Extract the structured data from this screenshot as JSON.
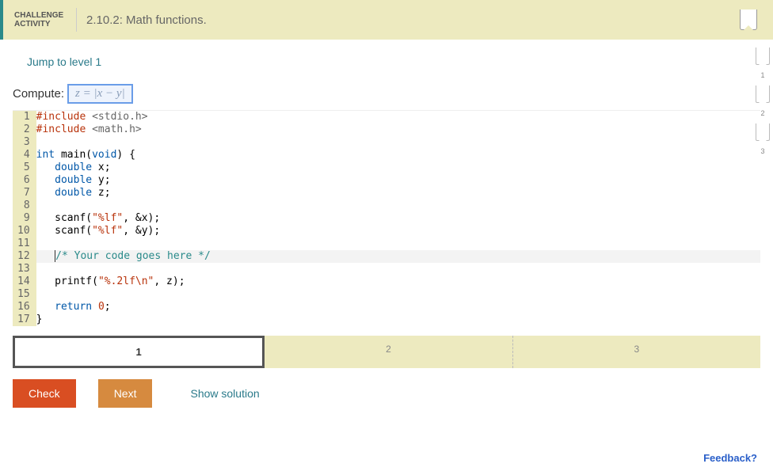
{
  "header": {
    "challenge_label_l1": "CHALLENGE",
    "challenge_label_l2": "ACTIVITY",
    "title": "2.10.2: Math functions."
  },
  "jump_link": "Jump to level 1",
  "compute": {
    "prefix": "Compute:",
    "formula": "z = |x − y|"
  },
  "code_lines": [
    {
      "n": 1,
      "html": "<span class='pp'>#include</span> <span class='inc'>&lt;stdio.h&gt;</span>"
    },
    {
      "n": 2,
      "html": "<span class='pp'>#include</span> <span class='inc'>&lt;math.h&gt;</span>"
    },
    {
      "n": 3,
      "html": ""
    },
    {
      "n": 4,
      "html": "<span class='kw'>int</span> main(<span class='kw'>void</span>) {"
    },
    {
      "n": 5,
      "html": "   <span class='typ'>double</span> x;"
    },
    {
      "n": 6,
      "html": "   <span class='typ'>double</span> y;"
    },
    {
      "n": 7,
      "html": "   <span class='typ'>double</span> z;"
    },
    {
      "n": 8,
      "html": ""
    },
    {
      "n": 9,
      "html": "   scanf(<span class='str'>\"%lf\"</span>, &amp;x);"
    },
    {
      "n": 10,
      "html": "   scanf(<span class='str'>\"%lf\"</span>, &amp;y);"
    },
    {
      "n": 11,
      "html": ""
    },
    {
      "n": 12,
      "html": "   <span class='cursor'></span><span class='cmt'>/* Your code goes here */</span>",
      "hl": true
    },
    {
      "n": 13,
      "html": ""
    },
    {
      "n": 14,
      "html": "   printf(<span class='str'>\"%.2lf\\n\"</span>, z);"
    },
    {
      "n": 15,
      "html": ""
    },
    {
      "n": 16,
      "html": "   <span class='kw'>return</span> <span class='num'>0</span>;"
    },
    {
      "n": 17,
      "html": "}"
    }
  ],
  "steps": [
    {
      "label": "1",
      "active": true
    },
    {
      "label": "2",
      "active": false
    },
    {
      "label": "3",
      "active": false
    }
  ],
  "buttons": {
    "check": "Check",
    "next": "Next",
    "show_solution": "Show solution"
  },
  "feedback": "Feedback?",
  "side_markers": [
    "1",
    "2",
    "3"
  ]
}
